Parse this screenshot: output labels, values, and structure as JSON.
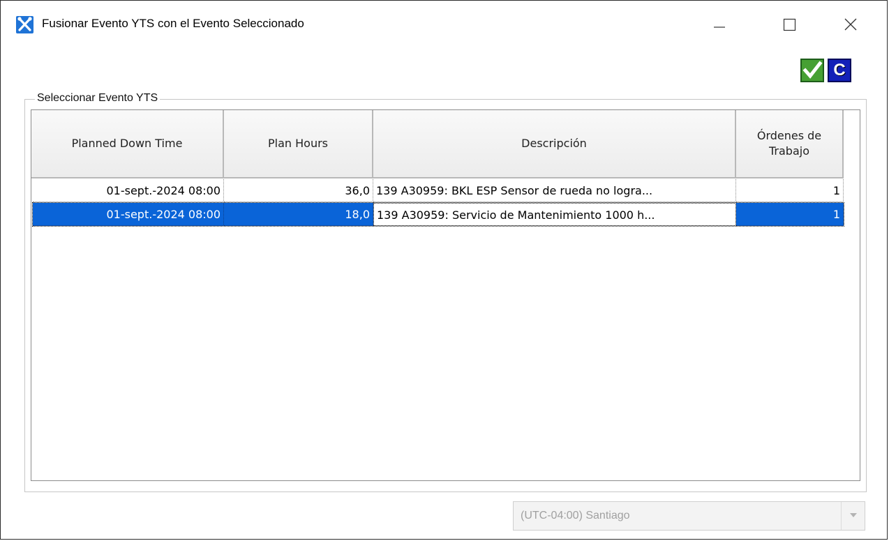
{
  "window": {
    "title": "Fusionar Evento YTS con el Evento Seleccionado"
  },
  "toolbar": {
    "confirm_icon": "checkmark-icon",
    "cancel_label": "C"
  },
  "group": {
    "legend": "Seleccionar Evento YTS"
  },
  "grid": {
    "columns": [
      "Planned Down Time",
      "Plan Hours",
      "Descripción",
      "Órdenes de Trabajo"
    ],
    "rows": [
      {
        "planned_down_time": "01-sept.-2024 08:00",
        "plan_hours": "36,0",
        "description": "139 A30959: BKL ESP Sensor de rueda no logra...",
        "work_orders": "1",
        "selected": false
      },
      {
        "planned_down_time": "01-sept.-2024 08:00",
        "plan_hours": "18,0",
        "description": "139 A30959: Servicio de Mantenimiento 1000 h...",
        "work_orders": "1",
        "selected": true
      }
    ]
  },
  "timezone": {
    "value": "(UTC-04:00) Santiago"
  },
  "colors": {
    "selection": "#0a64d8",
    "confirm_button": "#46a033",
    "cancel_button": "#1320b8"
  }
}
